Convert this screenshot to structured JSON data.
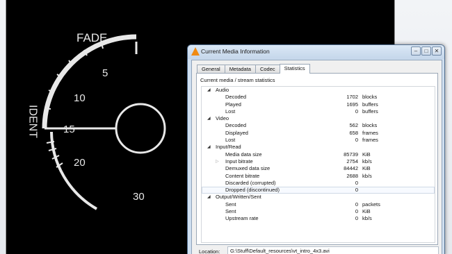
{
  "video": {
    "gauge": {
      "label_top": "FADE",
      "label_side": "IDENT",
      "ticks": [
        "5",
        "10",
        "15",
        "20",
        "30"
      ]
    }
  },
  "dialog": {
    "title": "Current Media Information",
    "window_buttons": [
      "–",
      "□",
      "✕"
    ],
    "tabs": [
      {
        "label": "General",
        "active": false
      },
      {
        "label": "Metadata",
        "active": false
      },
      {
        "label": "Codec",
        "active": false
      },
      {
        "label": "Statistics",
        "active": true
      }
    ],
    "panel_heading": "Current media / stream statistics",
    "stats": {
      "audio": {
        "title": "Audio",
        "rows": [
          {
            "label": "Decoded",
            "value": "1702",
            "unit": "blocks"
          },
          {
            "label": "Played",
            "value": "1695",
            "unit": "buffers"
          },
          {
            "label": "Lost",
            "value": "0",
            "unit": "buffers"
          }
        ]
      },
      "video": {
        "title": "Video",
        "rows": [
          {
            "label": "Decoded",
            "value": "562",
            "unit": "blocks"
          },
          {
            "label": "Displayed",
            "value": "658",
            "unit": "frames"
          },
          {
            "label": "Lost",
            "value": "0",
            "unit": "frames"
          }
        ]
      },
      "input": {
        "title": "Input/Read",
        "rows": [
          {
            "label": "Media data size",
            "value": "85739",
            "unit": "KiB"
          },
          {
            "label": "Input bitrate",
            "value": "2754",
            "unit": "kb/s"
          },
          {
            "label": "Demuxed data size",
            "value": "84442",
            "unit": "KiB"
          },
          {
            "label": "Content bitrate",
            "value": "2688",
            "unit": "kb/s"
          },
          {
            "label": "Discarded (corrupted)",
            "value": "0",
            "unit": ""
          },
          {
            "label": "Dropped (discontinued)",
            "value": "0",
            "unit": ""
          }
        ]
      },
      "output": {
        "title": "Output/Written/Sent",
        "rows": [
          {
            "label": "Sent",
            "value": "0",
            "unit": "packets"
          },
          {
            "label": "Sent",
            "value": "0",
            "unit": "KiB"
          },
          {
            "label": "Upstream rate",
            "value": "0",
            "unit": "kb/s"
          }
        ]
      }
    },
    "location": {
      "label": "Location:",
      "value": "G:\\Stuff\\Default_resources\\vt_intro_4x3.avi"
    }
  }
}
